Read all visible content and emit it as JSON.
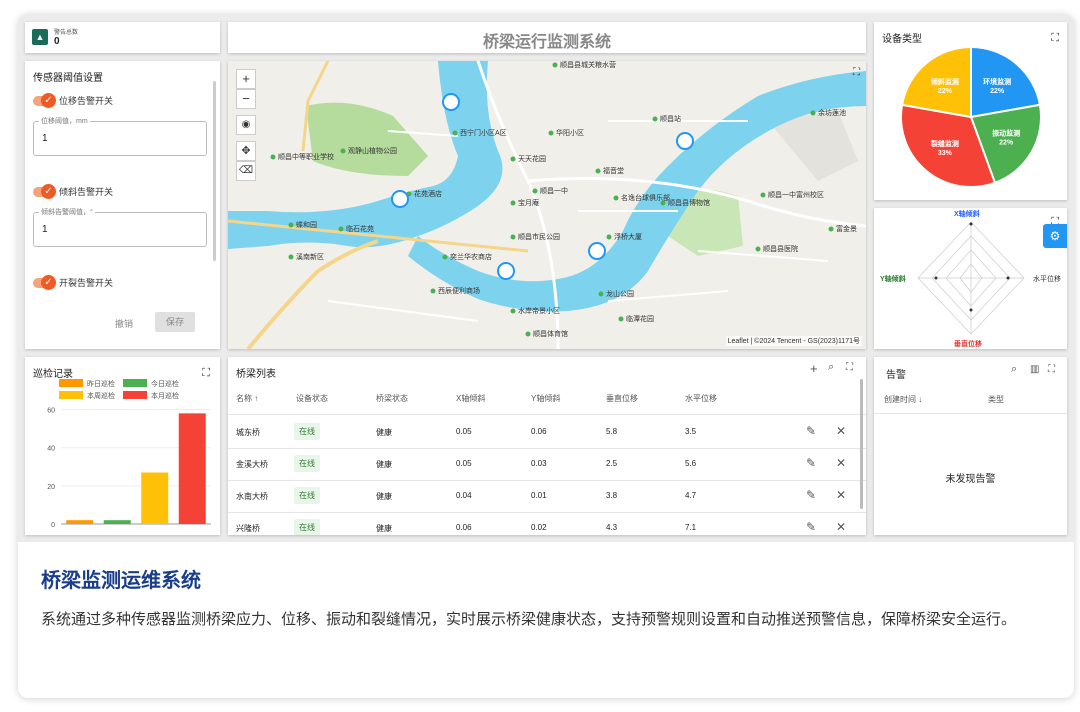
{
  "alarm": {
    "label": "警告总数",
    "count": "0"
  },
  "header": {
    "title": "桥梁运行监测系统"
  },
  "device_types": {
    "title": "设备类型",
    "slices": [
      {
        "name": "环境监测",
        "percent": "22%",
        "value": 22,
        "color": "#2196f3"
      },
      {
        "name": "振动监测",
        "percent": "22%",
        "value": 22,
        "color": "#4caf50"
      },
      {
        "name": "裂缝监测",
        "percent": "33%",
        "value": 33,
        "color": "#f44336"
      },
      {
        "name": "倾斜监测",
        "percent": "22%",
        "value": 22,
        "color": "#ffc107"
      }
    ]
  },
  "radar": {
    "top": "X轴倾斜",
    "left": "Y轴倾斜",
    "right": "水平位移",
    "bottom": "垂直位移"
  },
  "sensor": {
    "title": "传感器阈值设置",
    "displacement_toggle": "位移告警开关",
    "displacement_field_label": "位移阈值，mm",
    "displacement_value": "1",
    "tilt_toggle": "倾斜告警开关",
    "tilt_field_label": "倾斜告警阈值，°",
    "tilt_value": "1",
    "crack_toggle": "开裂告警开关",
    "cancel": "撤销",
    "save": "保存"
  },
  "map": {
    "attribution": "Leaflet | ©2024 Tencent - GS(2023)1171号",
    "labels": [
      "顺昌县城关粮水营",
      "西宁门小区A区",
      "华阳小区",
      "天天花园",
      "福音堂",
      "顺昌一中",
      "宝月庵",
      "名逸台球俱乐部",
      "顺昌县博物馆",
      "顺昌一中富州校区",
      "观静山植物公园",
      "顺昌中等职业学校",
      "花苑酒店",
      "蝶和园",
      "临石花苑",
      "溪南新区",
      "顺昌市民公园",
      "浮桥大厦",
      "顺昌县医院",
      "奕兰华农商店",
      "西辰便利商场",
      "水岸帝景小区",
      "顺昌体育馆",
      "龙山公园",
      "临潭花园",
      "余坊莲池",
      "富金景",
      "顺昌站"
    ]
  },
  "inspection": {
    "title": "巡检记录",
    "legend": [
      "昨日巡检",
      "今日巡检",
      "本周巡检",
      "本月巡检"
    ]
  },
  "chart_data": {
    "type": "bar",
    "categories": [
      "昨日巡检",
      "今日巡检",
      "本周巡检",
      "本月巡检"
    ],
    "values": [
      2,
      2,
      27,
      58
    ],
    "colors": [
      "#ff9800",
      "#4caf50",
      "#ffc107",
      "#f44336"
    ],
    "yticks": [
      0,
      20,
      40,
      60
    ],
    "ylim": [
      0,
      65
    ]
  },
  "bridge_list": {
    "title": "桥梁列表",
    "headers": [
      "名称 ↑",
      "设备状态",
      "桥梁状态",
      "X轴倾斜",
      "Y轴倾斜",
      "垂直位移",
      "水平位移"
    ],
    "rows": [
      {
        "name": "城东桥",
        "device": "在线",
        "bridge": "健康",
        "x": "0.05",
        "y": "0.06",
        "v": "5.8",
        "h": "3.5"
      },
      {
        "name": "金溪大桥",
        "device": "在线",
        "bridge": "健康",
        "x": "0.05",
        "y": "0.03",
        "v": "2.5",
        "h": "5.6"
      },
      {
        "name": "水南大桥",
        "device": "在线",
        "bridge": "健康",
        "x": "0.04",
        "y": "0.01",
        "v": "3.8",
        "h": "4.7"
      },
      {
        "name": "兴隆桥",
        "device": "在线",
        "bridge": "健康",
        "x": "0.06",
        "y": "0.02",
        "v": "4.3",
        "h": "7.1"
      }
    ]
  },
  "alerts": {
    "title": "告警",
    "col_time": "创建时间 ↓",
    "col_type": "类型",
    "empty": "未发现告警"
  },
  "description": {
    "title": "桥梁监测运维系统",
    "text": "系统通过多种传感器监测桥梁应力、位移、振动和裂缝情况，实时展示桥梁健康状态，支持预警规则设置和自动推送预警信息，保障桥梁安全运行。"
  }
}
